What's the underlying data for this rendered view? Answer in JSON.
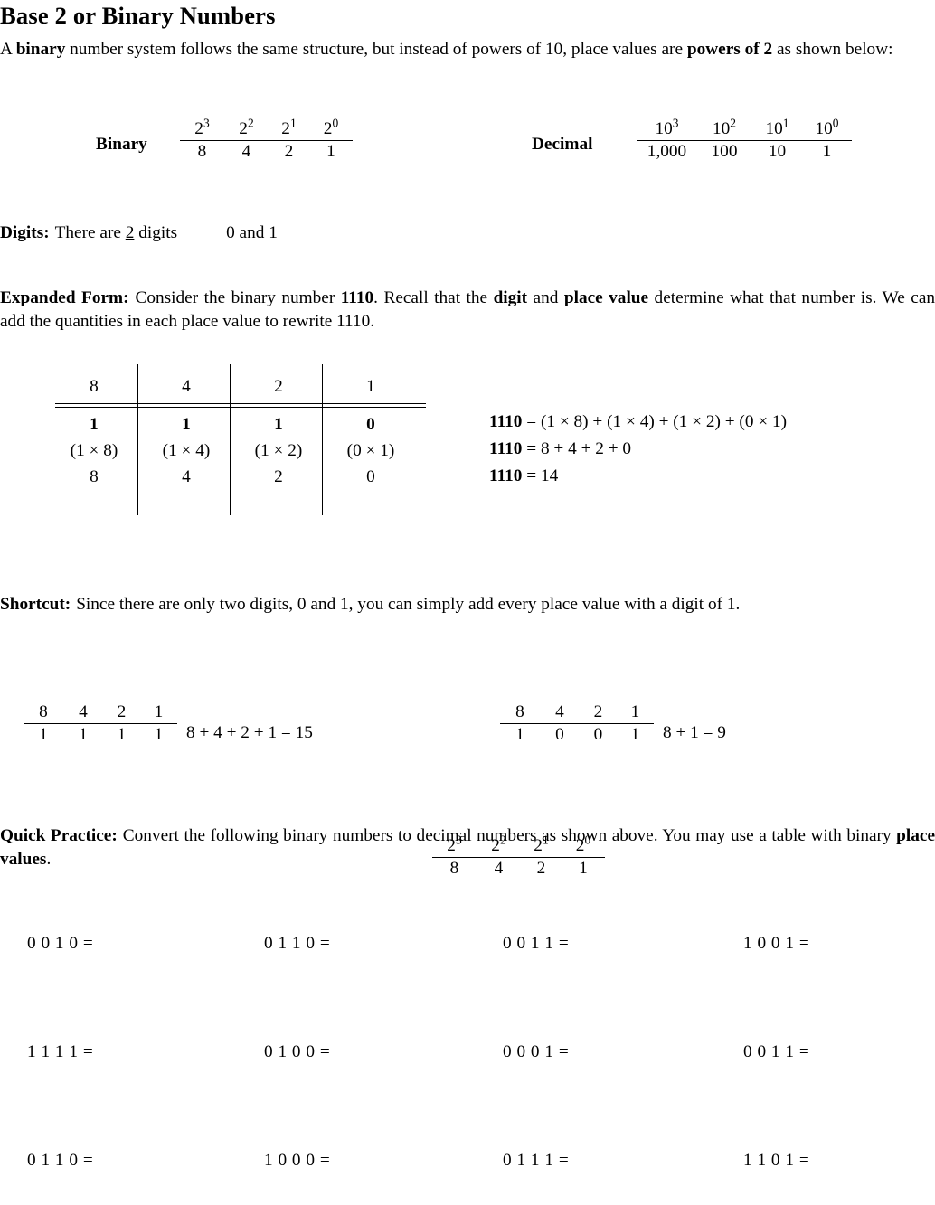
{
  "document": {
    "title": "Base 2 or Binary Numbers"
  },
  "intro": {
    "text_parts": {
      "p1": "A ",
      "b1": "binary",
      "p2": " number system follows the same structure, but instead of powers of 10, place values are ",
      "b2": "powers of 2",
      "p3": " as shown below:"
    },
    "full_text": "A binary number system follows the same structure, but instead of powers of 10, place values are powers of 2 as shown below:"
  },
  "binary_table": {
    "label": "Binary",
    "exponents": [
      "2",
      "2",
      "2",
      "2"
    ],
    "powers": [
      "3",
      "2",
      "1",
      "0"
    ],
    "values": [
      "8",
      "4",
      "2",
      "1"
    ]
  },
  "decimal_table": {
    "label": "Decimal",
    "exponents": [
      "10",
      "10",
      "10",
      "10"
    ],
    "powers": [
      "3",
      "2",
      "1",
      "0"
    ],
    "values": [
      "1,000",
      "100",
      "10",
      "1"
    ]
  },
  "digits": {
    "label": "Digits:",
    "text_before": "There are ",
    "underlined": "2",
    "text_after": " digits",
    "values": "0 and 1"
  },
  "expanded_form": {
    "label": "Expanded Form:",
    "text1": "Consider the binary number ",
    "number": "1110",
    "text2": ". Recall that the ",
    "bold1": "digit",
    "text3": " and ",
    "bold2": "place value",
    "text4": " determine what that number is. We can add the quantities in each place value to rewrite 1110."
  },
  "expanded_table": {
    "place_values": [
      "8",
      "4",
      "2",
      "1"
    ],
    "digits": [
      "1",
      "1",
      "1",
      "0"
    ],
    "products": [
      "(1 × 8)",
      "(1 × 4)",
      "(1 × 2)",
      "(0 × 1)"
    ],
    "results": [
      "8",
      "4",
      "2",
      "0"
    ]
  },
  "equations": [
    {
      "lhs": "1110",
      "rhs": "= (1 × 8) + (1 × 4) + (1 × 2) + (0 × 1)"
    },
    {
      "lhs": "1110",
      "rhs": "= 8 + 4 + 2 + 0"
    },
    {
      "lhs": "1110",
      "rhs": "= 14"
    }
  ],
  "shortcut": {
    "label": "Shortcut:",
    "text": "Since there are only two digits, 0 and 1, you can simply add every place value with a digit of 1."
  },
  "shortcut_examples": [
    {
      "place_values": [
        "8",
        "4",
        "2",
        "1"
      ],
      "digits": [
        "1",
        "1",
        "1",
        "1"
      ],
      "sum": "8 + 4 + 2 + 1 = 15"
    },
    {
      "place_values": [
        "8",
        "4",
        "2",
        "1"
      ],
      "digits": [
        "1",
        "0",
        "0",
        "1"
      ],
      "sum": "8 + 1 = 9"
    }
  ],
  "quick_practice": {
    "label": "Quick Practice:",
    "text1": "Convert the following binary numbers to decimal numbers as shown above. You may use a table with binary ",
    "bold1": "place values",
    "text2": ".",
    "table": {
      "exponents": [
        "2",
        "2",
        "2",
        "2"
      ],
      "powers": [
        "3",
        "2",
        "1",
        "0"
      ],
      "values": [
        "8",
        "4",
        "2",
        "1"
      ]
    }
  },
  "practice_problems": [
    [
      "0 0 1 0 =",
      "0 1 1 0 =",
      "0 0 1 1 =",
      "1 0 0 1 ="
    ],
    [
      "1 1 1 1 =",
      "0 1 0 0 =",
      "0 0 0 1 =",
      "0 0 1 1 ="
    ],
    [
      "0 1 1 0 =",
      "1 0 0 0 =",
      "0 1 1 1 =",
      "1 1 0 1 ="
    ]
  ],
  "colors": {
    "text": "#000000",
    "background": "#ffffff",
    "rule": "#000000"
  }
}
